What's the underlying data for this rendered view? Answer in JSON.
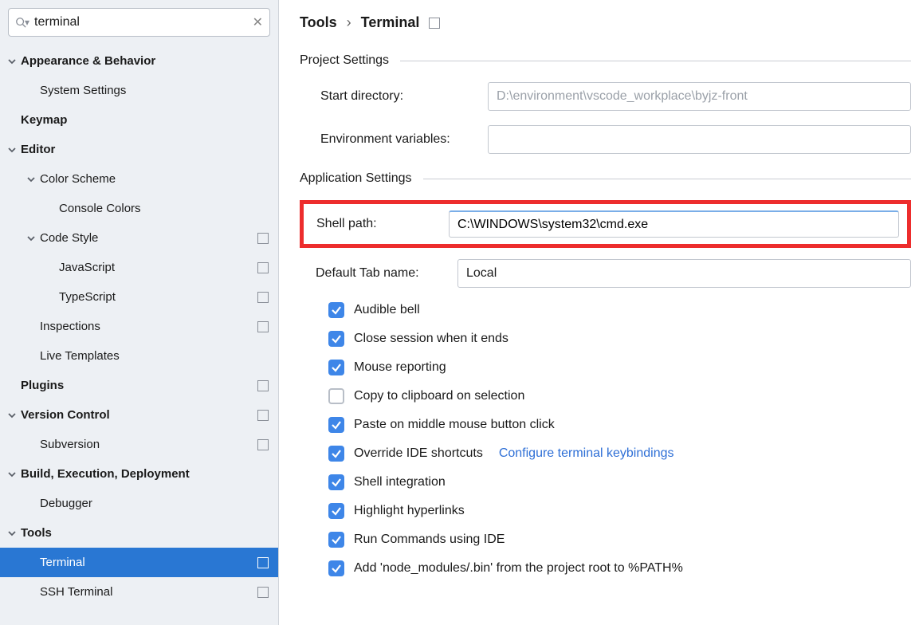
{
  "search": {
    "value": "terminal"
  },
  "tree": [
    {
      "label": "Appearance & Behavior",
      "level": 0,
      "bold": true,
      "expand": "open"
    },
    {
      "label": "System Settings",
      "level": 1
    },
    {
      "label": "Keymap",
      "level": 0,
      "bold": true
    },
    {
      "label": "Editor",
      "level": 0,
      "bold": true,
      "expand": "open"
    },
    {
      "label": "Color Scheme",
      "level": 1,
      "expand": "open"
    },
    {
      "label": "Console Colors",
      "level": 2
    },
    {
      "label": "Code Style",
      "level": 1,
      "expand": "open",
      "proj": true
    },
    {
      "label": "JavaScript",
      "level": 2,
      "proj": true
    },
    {
      "label": "TypeScript",
      "level": 2,
      "proj": true
    },
    {
      "label": "Inspections",
      "level": 1,
      "proj": true
    },
    {
      "label": "Live Templates",
      "level": 1
    },
    {
      "label": "Plugins",
      "level": 0,
      "bold": true,
      "proj": true
    },
    {
      "label": "Version Control",
      "level": 0,
      "bold": true,
      "expand": "open",
      "proj": true
    },
    {
      "label": "Subversion",
      "level": 1,
      "proj": true
    },
    {
      "label": "Build, Execution, Deployment",
      "level": 0,
      "bold": true,
      "expand": "open"
    },
    {
      "label": "Debugger",
      "level": 1
    },
    {
      "label": "Tools",
      "level": 0,
      "bold": true,
      "expand": "open"
    },
    {
      "label": "Terminal",
      "level": 1,
      "proj": true,
      "selected": true
    },
    {
      "label": "SSH Terminal",
      "level": 1,
      "proj": true
    }
  ],
  "breadcrumb": {
    "root": "Tools",
    "leaf": "Terminal"
  },
  "sections": {
    "project": "Project Settings",
    "app": "Application Settings"
  },
  "fields": {
    "start_dir_label": "Start directory:",
    "start_dir_value": "D:\\environment\\vscode_workplace\\byjz-front",
    "env_label": "Environment variables:",
    "env_value": "",
    "shell_label": "Shell path:",
    "shell_value": "C:\\WINDOWS\\system32\\cmd.exe",
    "tab_label": "Default Tab name:",
    "tab_value": "Local"
  },
  "checks": [
    {
      "label": "Audible bell",
      "checked": true
    },
    {
      "label": "Close session when it ends",
      "checked": true
    },
    {
      "label": "Mouse reporting",
      "checked": true
    },
    {
      "label": "Copy to clipboard on selection",
      "checked": false
    },
    {
      "label": "Paste on middle mouse button click",
      "checked": true
    },
    {
      "label": "Override IDE shortcuts",
      "checked": true,
      "link": "Configure terminal keybindings"
    },
    {
      "label": "Shell integration",
      "checked": true
    },
    {
      "label": "Highlight hyperlinks",
      "checked": true
    },
    {
      "label": "Run Commands using IDE",
      "checked": true
    },
    {
      "label": "Add 'node_modules/.bin' from the project root to %PATH%",
      "checked": true
    }
  ]
}
